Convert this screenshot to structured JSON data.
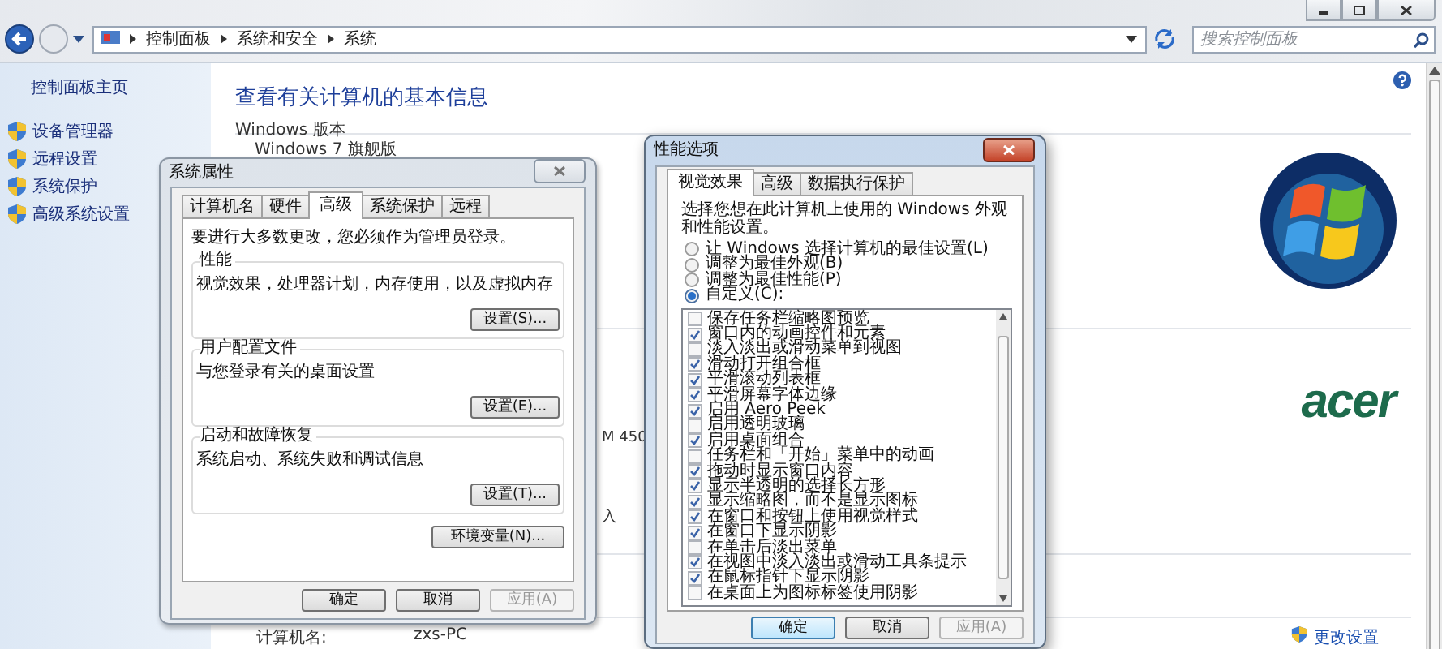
{
  "address_bar": {
    "breadcrumbs": [
      "控制面板",
      "系统和安全",
      "系统"
    ]
  },
  "search": {
    "placeholder": "搜索控制面板"
  },
  "sidebar": {
    "home": "控制面板主页",
    "items": [
      "设备管理器",
      "远程设置",
      "系统保护",
      "高级系统设置"
    ]
  },
  "main": {
    "title": "查看有关计算机的基本信息",
    "section": "Windows 版本",
    "edition": "Windows 7 旗舰版",
    "fragments": [
      "M 450",
      "入"
    ],
    "brand": "acer",
    "computer_name_label": "计算机名:",
    "computer_name": "zxs-PC",
    "change_link": "更改设置"
  },
  "system_properties": {
    "title": "系统属性",
    "active": false,
    "tabs": [
      {
        "label": "计算机名",
        "selected": false
      },
      {
        "label": "硬件",
        "selected": false
      },
      {
        "label": "高级",
        "selected": true
      },
      {
        "label": "系统保护",
        "selected": false
      },
      {
        "label": "远程",
        "selected": false
      }
    ],
    "notice": "要进行大多数更改，您必须作为管理员登录。",
    "groups": [
      {
        "title": "性能",
        "description": "视觉效果，处理器计划，内存使用，以及虚拟内存",
        "button": "设置(S)..."
      },
      {
        "title": "用户配置文件",
        "description": "与您登录有关的桌面设置",
        "button": "设置(E)..."
      },
      {
        "title": "启动和故障恢复",
        "description": "系统启动、系统失败和调试信息",
        "button": "设置(T)..."
      }
    ],
    "env_button": "环境变量(N)...",
    "buttons": [
      {
        "label": "确定",
        "disabled": false
      },
      {
        "label": "取消",
        "disabled": false
      },
      {
        "label": "应用(A)",
        "disabled": true
      }
    ]
  },
  "performance_options": {
    "title": "性能选项",
    "active": true,
    "tabs": [
      {
        "label": "视觉效果",
        "selected": true
      },
      {
        "label": "高级",
        "selected": false
      },
      {
        "label": "数据执行保护",
        "selected": false
      }
    ],
    "intro": "选择您想在此计算机上使用的 Windows 外观和性能设置。",
    "options": [
      {
        "label": "让 Windows 选择计算机的最佳设置(L)",
        "selected": false
      },
      {
        "label": "调整为最佳外观(B)",
        "selected": false
      },
      {
        "label": "调整为最佳性能(P)",
        "selected": false
      },
      {
        "label": "自定义(C):",
        "selected": true
      }
    ],
    "effects": [
      {
        "label": "保存任务栏缩略图预览",
        "checked": false
      },
      {
        "label": "窗口内的动画控件和元素",
        "checked": true
      },
      {
        "label": "淡入淡出或滑动菜单到视图",
        "checked": false
      },
      {
        "label": "滑动打开组合框",
        "checked": true
      },
      {
        "label": "平滑滚动列表框",
        "checked": true
      },
      {
        "label": "平滑屏幕字体边缘",
        "checked": true
      },
      {
        "label": "启用 Aero Peek",
        "checked": true
      },
      {
        "label": "启用透明玻璃",
        "checked": false
      },
      {
        "label": "启用桌面组合",
        "checked": true
      },
      {
        "label": "任务栏和「开始」菜单中的动画",
        "checked": false
      },
      {
        "label": "拖动时显示窗口内容",
        "checked": true
      },
      {
        "label": "显示半透明的选择长方形",
        "checked": true
      },
      {
        "label": "显示缩略图，而不是显示图标",
        "checked": true
      },
      {
        "label": "在窗口和按钮上使用视觉样式",
        "checked": true
      },
      {
        "label": "在窗口下显示阴影",
        "checked": true
      },
      {
        "label": "在单击后淡出菜单",
        "checked": false
      },
      {
        "label": "在视图中淡入淡出或滑动工具条提示",
        "checked": true
      },
      {
        "label": "在鼠标指针下显示阴影",
        "checked": true
      },
      {
        "label": "在桌面上为图标标签使用阴影",
        "checked": false
      }
    ],
    "buttons": [
      {
        "label": "确定",
        "disabled": false
      },
      {
        "label": "取消",
        "disabled": false
      },
      {
        "label": "应用(A)",
        "disabled": true
      }
    ]
  }
}
